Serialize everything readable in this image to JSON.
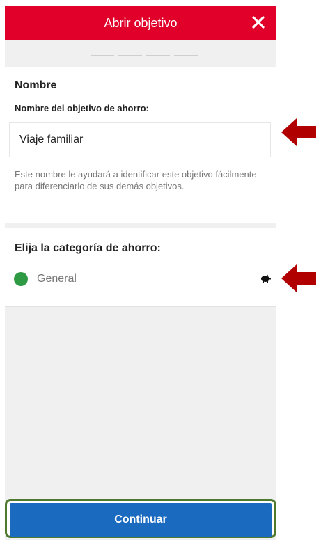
{
  "header": {
    "title": "Abrir objetivo",
    "close_icon": "close-icon"
  },
  "stepper": {
    "steps": 4
  },
  "name_section": {
    "title": "Nombre",
    "field_label": "Nombre del objetivo de ahorro:",
    "field_value": "Viaje familiar",
    "helper_text": "Este nombre le ayudará a identificar este objetivo fácilmente para diferenciarlo de sus demás objetivos."
  },
  "category_section": {
    "title": "Elija la categoría de ahorro:",
    "selected": {
      "label": "General",
      "color": "#2e9a44",
      "icon": "piggy-bank-icon"
    }
  },
  "footer": {
    "continue_label": "Continuar"
  },
  "colors": {
    "header": "#e0002a",
    "button": "#1a6bbf",
    "annotation_arrow": "#b00000",
    "annotation_frame": "#4f7a2e"
  }
}
